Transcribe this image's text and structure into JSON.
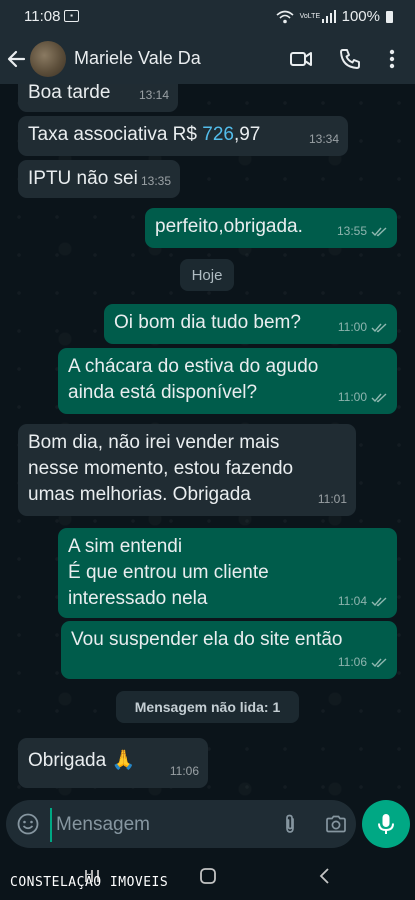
{
  "status_bar": {
    "time": "11:08",
    "network": "VoLTE",
    "battery": "100%"
  },
  "header": {
    "contact_name": "Mariele Vale Da"
  },
  "messages": [
    {
      "direction": "in",
      "text": "Boa tarde",
      "time": "13:14"
    },
    {
      "direction": "in",
      "text_before": "Taxa associativa R$ ",
      "text_link": "726",
      "text_after": ",97",
      "time": "13:34"
    },
    {
      "direction": "in",
      "text": "IPTU não sei",
      "time": "13:35"
    },
    {
      "direction": "out",
      "text": "perfeito,obrigada.",
      "time": "13:55",
      "read": true
    },
    {
      "direction": "out",
      "text": "Oi bom dia tudo bem?",
      "time": "11:00",
      "read": true
    },
    {
      "direction": "out",
      "text": "A chácara do estiva do agudo\nainda está disponível?",
      "time": "11:00",
      "read": true
    },
    {
      "direction": "in",
      "text": "Bom dia, não irei vender mais\nnesse momento,  estou fazendo\numas melhorias.  Obrigada",
      "time": "11:01"
    },
    {
      "direction": "out",
      "text": "A sim entendi\nÉ  que entrou um cliente\ninteressado nela",
      "time": "11:04",
      "read": true
    },
    {
      "direction": "out",
      "text": "Vou suspender  ela do site então",
      "time": "11:06",
      "read": true
    },
    {
      "direction": "in",
      "text": "Obrigada 🙏",
      "time": "11:06"
    }
  ],
  "day_separator": "Hoje",
  "unread_separator": "Mensagem não lida: 1",
  "composer": {
    "placeholder": "Mensagem"
  },
  "icons": {
    "back": "arrow-left-icon",
    "video": "video-camera-icon",
    "call": "phone-icon",
    "menu": "more-vert-icon",
    "emoji": "emoji-icon",
    "attach": "paperclip-icon",
    "camera": "camera-icon",
    "mic": "mic-icon"
  },
  "colors": {
    "incoming_bubble": "#202c33",
    "outgoing_bubble": "#005c4b",
    "accent": "#00a884",
    "read_receipt": "#53bdeb"
  },
  "watermark": "CONSTELAÇÃO IMOVEIS"
}
